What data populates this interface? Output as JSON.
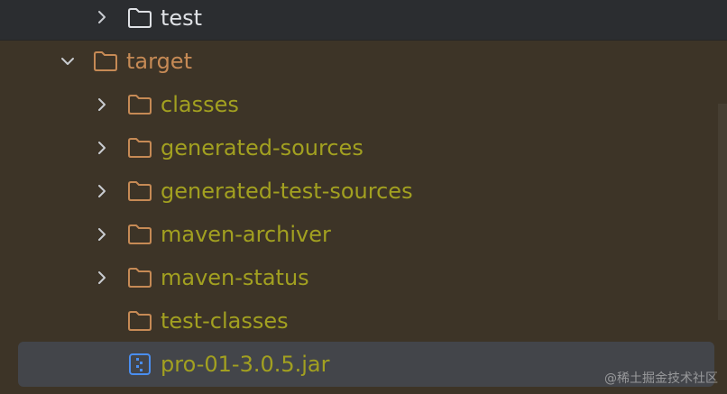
{
  "tree": {
    "items": [
      {
        "label": "test",
        "expanded": false,
        "icon": "folder-icon",
        "type": "folder"
      },
      {
        "label": "target",
        "expanded": true,
        "icon": "folder-icon",
        "type": "folder"
      },
      {
        "label": "classes",
        "expanded": false,
        "icon": "folder-icon",
        "type": "folder"
      },
      {
        "label": "generated-sources",
        "expanded": false,
        "icon": "folder-icon",
        "type": "folder"
      },
      {
        "label": "generated-test-sources",
        "expanded": false,
        "icon": "folder-icon",
        "type": "folder"
      },
      {
        "label": "maven-archiver",
        "expanded": false,
        "icon": "folder-icon",
        "type": "folder"
      },
      {
        "label": "maven-status",
        "expanded": false,
        "icon": "folder-icon",
        "type": "folder"
      },
      {
        "label": "test-classes",
        "expanded": false,
        "icon": "folder-icon",
        "type": "folder"
      },
      {
        "label": "pro-01-3.0.5.jar",
        "expanded": false,
        "icon": "jar-icon",
        "type": "file",
        "selected": true
      }
    ]
  },
  "colors": {
    "background": "#3d3427",
    "top_row_background": "#2b2d30",
    "selection_background": "#43454a",
    "label_olive": "#a2a020",
    "label_white": "#dfe1e5",
    "label_orange": "#c68a55",
    "folder_outline": "#c68a55",
    "folder_outline_white": "#dfe1e5",
    "jar_blue": "#4a8ef0"
  },
  "watermark": "@稀土掘金技术社区"
}
